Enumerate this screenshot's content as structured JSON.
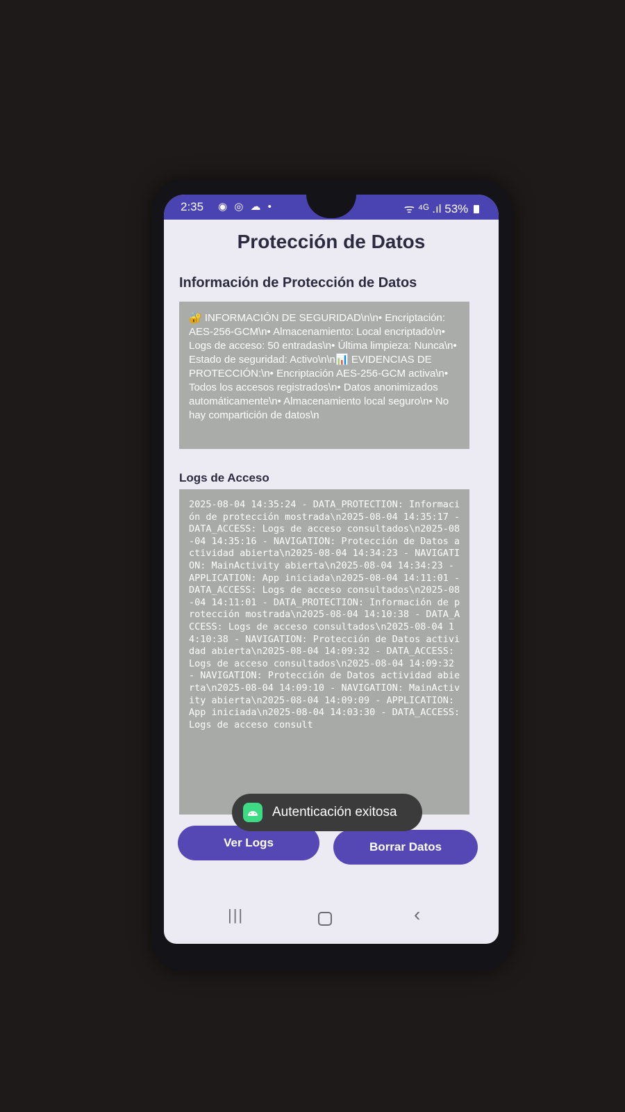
{
  "status_bar": {
    "time": "2:35",
    "notification_icons": "◉ ◎ ☁ •",
    "signal_text": "ᯤ ⁴ᴳ .ıl",
    "battery": "53%"
  },
  "page_title": "Protección de Datos",
  "info_section": {
    "title": "Información de Protección de Datos",
    "text": "🔐 INFORMACIÓN DE SEGURIDAD\\n\\n• Encriptación: AES-256-GCM\\n• Almacenamiento: Local encriptado\\n• Logs de acceso: 50 entradas\\n• Última limpieza: Nunca\\n• Estado de seguridad: Activo\\n\\n📊 EVIDENCIAS DE PROTECCIÓN:\\n• Encriptación AES-256-GCM activa\\n• Todos los accesos registrados\\n• Datos anonimizados automáticamente\\n• Almacenamiento local seguro\\n• No hay compartición de datos\\n"
  },
  "logs_section": {
    "title": "Logs de Acceso",
    "text": "2025-08-04 14:35:24 - DATA_PROTECTION: Información de protección mostrada\\n2025-08-04 14:35:17 - DATA_ACCESS: Logs de acceso consultados\\n2025-08-04 14:35:16 - NAVIGATION: Protección de Datos actividad abierta\\n2025-08-04 14:34:23 - NAVIGATION: MainActivity abierta\\n2025-08-04 14:34:23 - APPLICATION: App iniciada\\n2025-08-04 14:11:01 - DATA_ACCESS: Logs de acceso consultados\\n2025-08-04 14:11:01 - DATA_PROTECTION: Información de protección mostrada\\n2025-08-04 14:10:38 - DATA_ACCESS: Logs de acceso consultados\\n2025-08-04 14:10:38 - NAVIGATION: Protección de Datos actividad abierta\\n2025-08-04 14:09:32 - DATA_ACCESS: Logs de acceso consultados\\n2025-08-04 14:09:32 - NAVIGATION: Protección de Datos actividad abierta\\n2025-08-04 14:09:10 - NAVIGATION: MainActivity abierta\\n2025-08-04 14:09:09 - APPLICATION: App iniciada\\n2025-08-04 14:03:30 - DATA_ACCESS: Logs de acceso consult"
  },
  "toast": {
    "message": "Autenticación exitosa"
  },
  "buttons": {
    "view_logs": "Ver Logs",
    "clear_data": "Borrar Datos"
  },
  "nav_bar": {
    "recents": "|||",
    "back": "‹"
  },
  "colors": {
    "status_bar": "#4a44b3",
    "button": "#5548b5",
    "content_box": "#a9aca9",
    "screen_bg": "#ecebf3"
  }
}
